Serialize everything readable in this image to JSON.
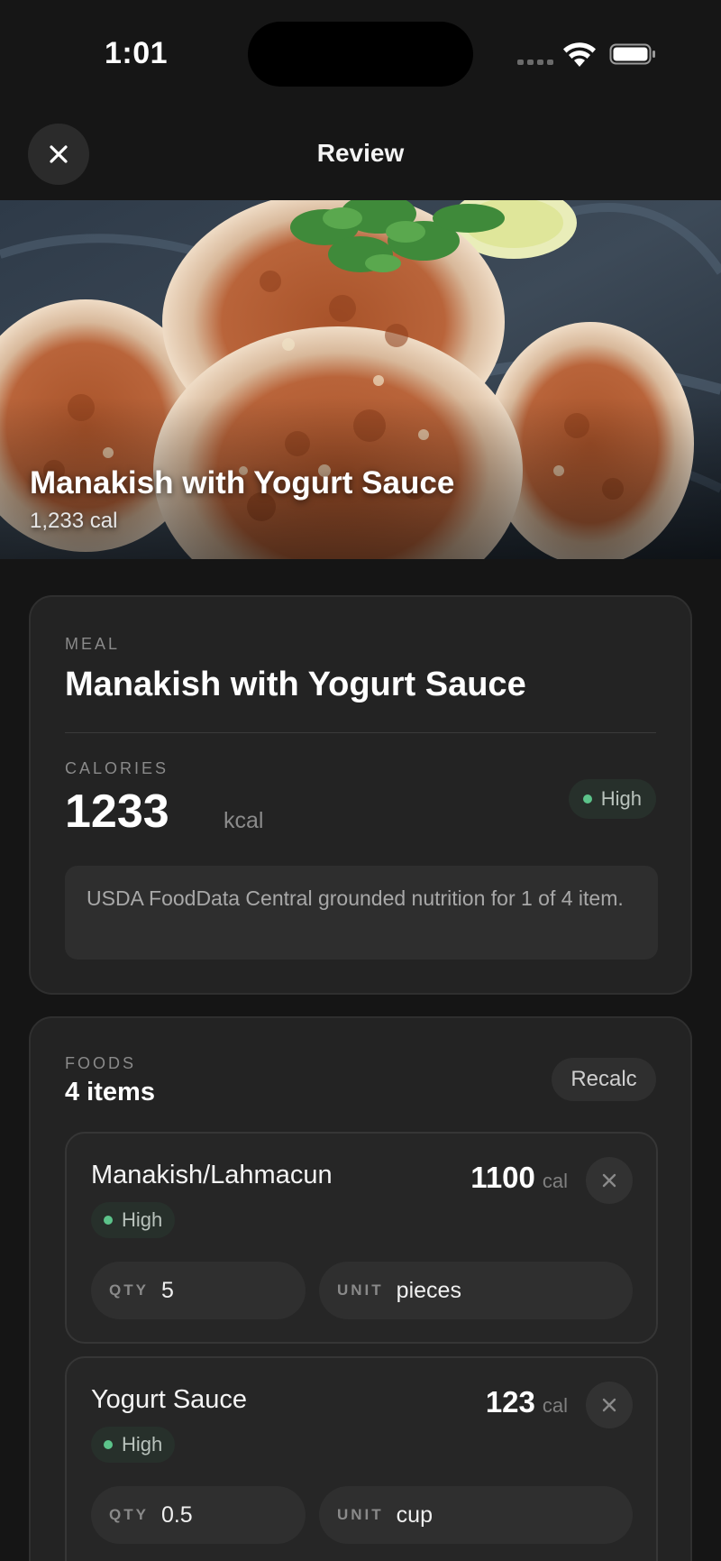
{
  "status_bar": {
    "time": "1:01"
  },
  "header": {
    "title": "Review"
  },
  "hero": {
    "title": "Manakish with Yogurt Sauce",
    "calories": "1,233 cal"
  },
  "meal_card": {
    "meal_label": "MEAL",
    "meal_name": "Manakish with Yogurt Sauce",
    "calories_label": "CALORIES",
    "calories_value": "1233",
    "calories_unit": "kcal",
    "confidence": "High",
    "note": "USDA FoodData Central grounded nutrition for 1 of 4 item."
  },
  "foods_card": {
    "label": "FOODS",
    "count": "4 items",
    "recalc_label": "Recalc",
    "items": [
      {
        "name": "Manakish/Lahmacun",
        "calories": "1100",
        "cal_unit": "cal",
        "confidence": "High",
        "qty_label": "QTY",
        "qty": "5",
        "unit_label": "UNIT",
        "unit": "pieces"
      },
      {
        "name": "Yogurt Sauce",
        "calories": "123",
        "cal_unit": "cal",
        "confidence": "High",
        "qty_label": "QTY",
        "qty": "0.5",
        "unit_label": "UNIT",
        "unit": "cup"
      }
    ]
  },
  "colors": {
    "background": "#151515",
    "card": "#232323",
    "confidence_dot": "#5cc38a"
  }
}
